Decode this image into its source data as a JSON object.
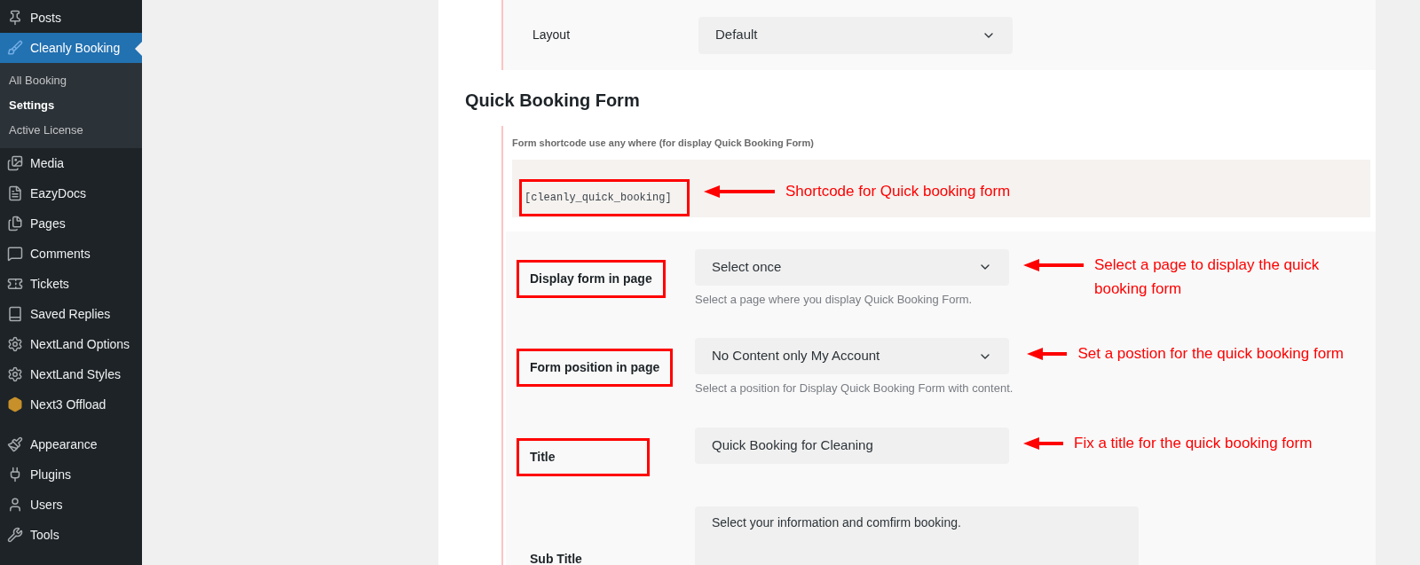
{
  "sidebar": {
    "items": [
      {
        "label": "Posts",
        "selected": false
      },
      {
        "label": "Cleanly Booking",
        "selected": true,
        "children": [
          {
            "label": "All Booking",
            "selected": false
          },
          {
            "label": "Settings",
            "selected": true
          },
          {
            "label": "Active License",
            "selected": false
          }
        ]
      },
      {
        "label": "Media",
        "selected": false
      },
      {
        "label": "EazyDocs",
        "selected": false
      },
      {
        "label": "Pages",
        "selected": false
      },
      {
        "label": "Comments",
        "selected": false
      },
      {
        "label": "Tickets",
        "selected": false
      },
      {
        "label": "Saved Replies",
        "selected": false
      },
      {
        "label": "NextLand Options",
        "selected": false
      },
      {
        "label": "NextLand Styles",
        "selected": false
      },
      {
        "label": "Next3 Offload",
        "selected": false
      },
      {
        "label": "Appearance",
        "selected": false
      },
      {
        "label": "Plugins",
        "selected": false
      },
      {
        "label": "Users",
        "selected": false
      },
      {
        "label": "Tools",
        "selected": false
      }
    ]
  },
  "layout_row": {
    "label": "Layout",
    "value": "Default"
  },
  "section": {
    "heading": "Quick Booking Form",
    "shortcode_note": "Form shortcode use any where (for display Quick Booking Form)",
    "shortcode": "[cleanly_quick_booking]",
    "shortcode_highlighted": true,
    "shortcode_annotation": "Shortcode for Quick booking form",
    "fields": [
      {
        "kind": "select",
        "label": "Display form in page",
        "value": "Select once",
        "hint": "Select a page where you display Quick Booking Form.",
        "highlighted": true,
        "annotation": "Select a page to display the quick booking form"
      },
      {
        "kind": "select",
        "label": "Form position in page",
        "value": "No Content only My Account",
        "hint": "Select a position for Display Quick Booking Form with content.",
        "highlighted": true,
        "annotation": "Set a postion for the quick booking form"
      },
      {
        "kind": "text",
        "label": "Title",
        "value": "Quick Booking for Cleaning",
        "highlighted": true,
        "annotation": "Fix a title for the quick booking form"
      },
      {
        "kind": "textarea",
        "label": "Sub Title",
        "value": "Select your information and comfirm booking.",
        "highlighted": false
      }
    ]
  }
}
